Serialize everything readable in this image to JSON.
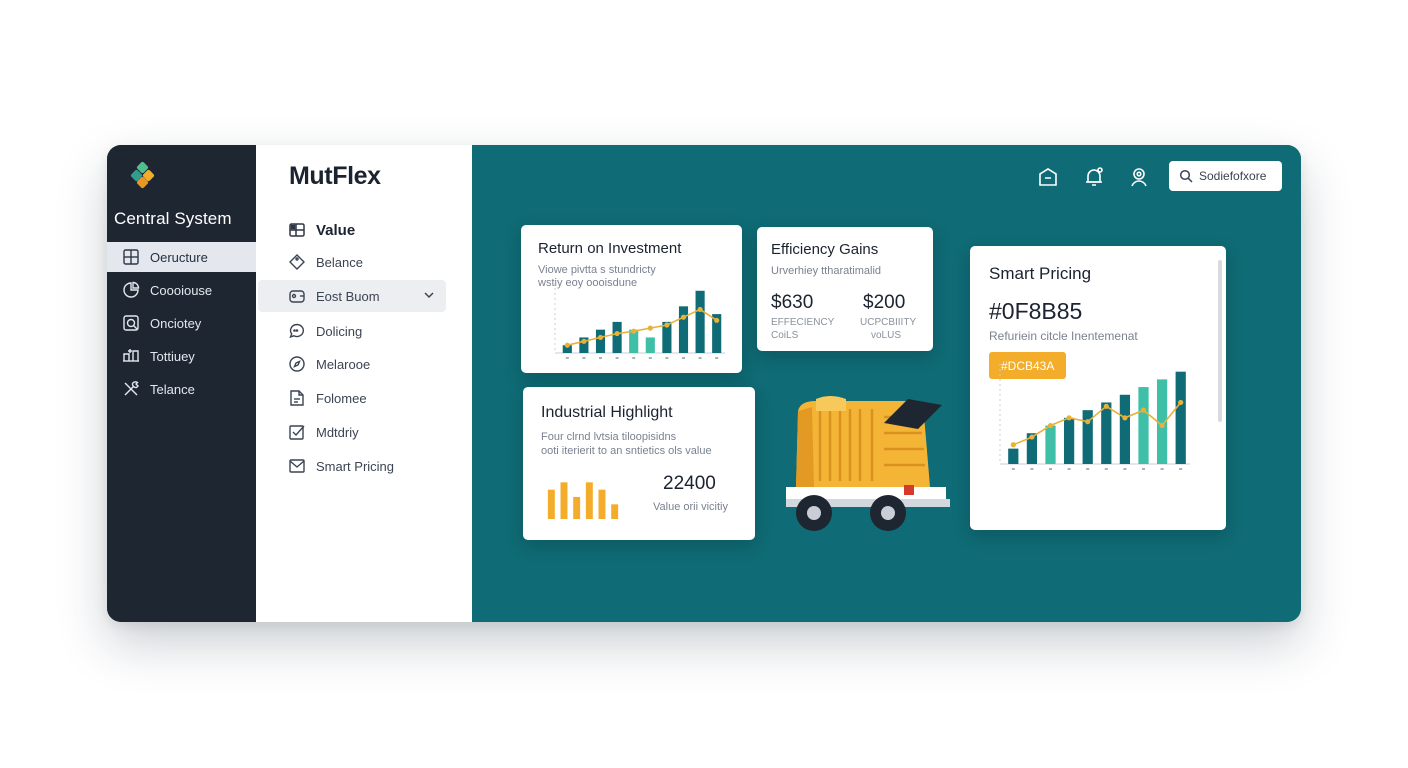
{
  "colors": {
    "sidebar": "#1e2631",
    "main": "#0f6b75",
    "accent_teal": "#0f6b75",
    "accent_mint": "#3fbfa8",
    "accent_orange": "#f4ad2b",
    "text_dark": "#1b2330"
  },
  "sidebar": {
    "app_title": "Central System",
    "items": [
      {
        "label": "Oeructure",
        "icon": "grid-icon"
      },
      {
        "label": "Coooiouse",
        "icon": "pie-chart-icon"
      },
      {
        "label": "Onciotey",
        "icon": "target-icon"
      },
      {
        "label": "Tottiuey",
        "icon": "transfer-icon"
      },
      {
        "label": "Telance",
        "icon": "wrench-icon"
      }
    ]
  },
  "panel": {
    "title": "MutFlex",
    "heading": "Value",
    "items": [
      {
        "label": "Belance",
        "icon": "tag-icon"
      },
      {
        "label": "Eost Buom",
        "icon": "wallet-icon"
      },
      {
        "label": "Dolicing",
        "icon": "chat-icon"
      },
      {
        "label": "Melarooe",
        "icon": "compass-icon"
      },
      {
        "label": "Folomee",
        "icon": "document-icon"
      },
      {
        "label": "Mdtdriy",
        "icon": "checkbox-icon"
      },
      {
        "label": "Smart Pricing",
        "icon": "envelope-icon"
      }
    ]
  },
  "topbar": {
    "icons": [
      "home-icon",
      "bell-icon",
      "user-location-icon"
    ],
    "search_placeholder": "Sodiefofxore"
  },
  "cards": {
    "roi": {
      "title": "Return on Investment",
      "subtitle_1": "Viowe pivtta s stundricty",
      "subtitle_2": "wstiy eoy oooisdune"
    },
    "efficiency": {
      "title": "Efficiency Gains",
      "subtitle": "Urverhiey ttharatimalid",
      "left_value": "$630",
      "left_caption_1": "EFFECIENCY",
      "left_caption_2": "CoiLS",
      "right_value": "$200",
      "right_caption_1": "UCPCBIIITY",
      "right_caption_2": "voLUS"
    },
    "industrial": {
      "title": "Industrial Highlight",
      "subtitle_1": "Four clrnd lvtsia tiloopisidns",
      "subtitle_2": "ooti iterierit to an sntietics ols value",
      "value": "22400",
      "value_caption": "Value orii vicitiy"
    },
    "pricing": {
      "title": "Smart Pricing",
      "code": "#0F8B85",
      "subtitle": "Refuriein citcle Inentemenat",
      "badge": "#DCB43A"
    }
  },
  "chart_data": [
    {
      "type": "bar",
      "name": "roi-chart",
      "series": [
        {
          "values": [
            1,
            2,
            3,
            4,
            3,
            2,
            4,
            6,
            8,
            5
          ]
        }
      ],
      "line": [
        1.0,
        1.5,
        2.0,
        2.5,
        2.8,
        3.2,
        3.6,
        4.6,
        5.6,
        4.2
      ],
      "ylim": [
        0,
        9
      ]
    },
    {
      "type": "bar",
      "name": "industrial-chart",
      "series": [
        {
          "values": [
            4,
            5,
            3,
            5,
            4,
            2
          ]
        }
      ],
      "ylim": [
        0,
        6
      ]
    },
    {
      "type": "bar",
      "name": "pricing-chart",
      "series": [
        {
          "values": [
            2,
            4,
            5,
            6,
            7,
            8,
            9,
            10,
            11,
            12
          ]
        }
      ],
      "line": [
        2.5,
        3.5,
        5.0,
        6.0,
        5.5,
        7.5,
        6.0,
        7.0,
        5.0,
        8.0
      ],
      "ylim": [
        0,
        13
      ]
    }
  ]
}
